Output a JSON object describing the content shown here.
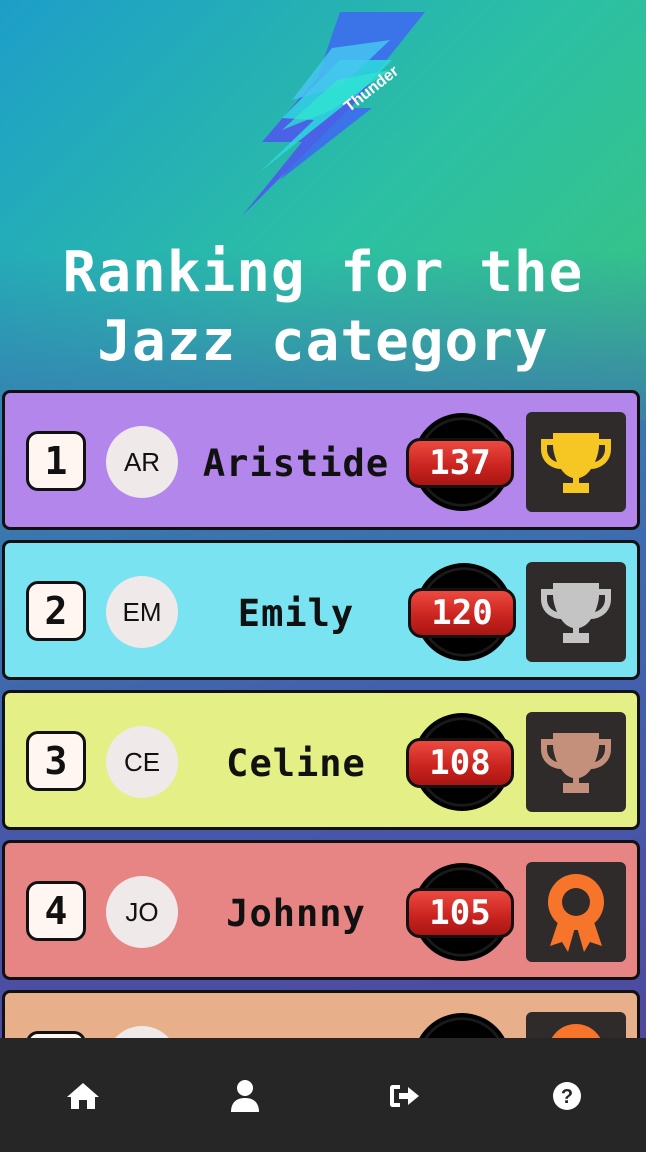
{
  "logo": {
    "text": "Thunder"
  },
  "title": {
    "line1": "Ranking for the",
    "line2": "Jazz category"
  },
  "ranking": [
    {
      "rank": "1",
      "initials": "AR",
      "name": "Aristide",
      "score": "137",
      "award": "trophy-gold-icon",
      "bg": "#b386ec"
    },
    {
      "rank": "2",
      "initials": "EM",
      "name": "Emily",
      "score": "120",
      "award": "trophy-silver-icon",
      "bg": "#7ae3f2"
    },
    {
      "rank": "3",
      "initials": "CE",
      "name": "Celine",
      "score": "108",
      "award": "trophy-bronze-icon",
      "bg": "#e4ef85"
    },
    {
      "rank": "4",
      "initials": "JO",
      "name": "Johnny",
      "score": "105",
      "award": "rosette-icon",
      "bg": "#e78585"
    },
    {
      "rank": "",
      "initials": "",
      "name": "",
      "score": "",
      "award": "rosette-icon",
      "bg": "#e8b08a"
    }
  ],
  "colors": {
    "gold": "#f6c622",
    "silver": "#c4c4c4",
    "bronze": "#c5907b",
    "rosette": "#f7752a",
    "navbar": "#262626"
  },
  "nav": {
    "items": [
      "home-icon",
      "user-icon",
      "logout-icon",
      "help-icon"
    ]
  }
}
